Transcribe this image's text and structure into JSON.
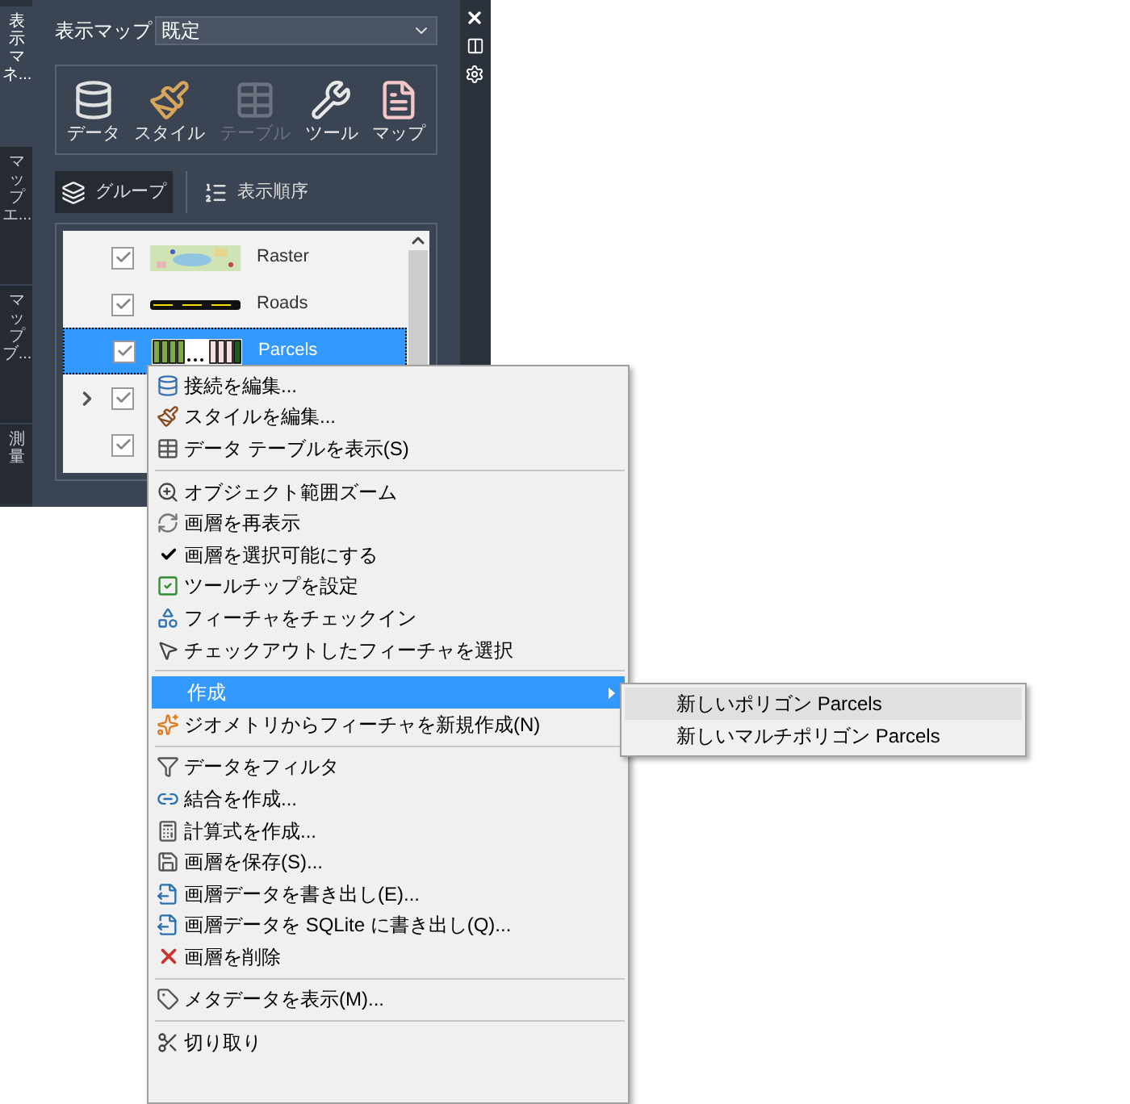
{
  "side_tabs": [
    {
      "label": "表示マネ...",
      "selected": true
    },
    {
      "label": "マップエ...",
      "selected": false
    },
    {
      "label": "マップブ...",
      "selected": false
    },
    {
      "label": "測量",
      "selected": false
    }
  ],
  "map_select": {
    "label": "表示マップ",
    "value": "既定"
  },
  "toolbar": [
    {
      "label": "データ",
      "disabled": false
    },
    {
      "label": "スタイル",
      "disabled": false
    },
    {
      "label": "テーブル",
      "disabled": true
    },
    {
      "label": "ツール",
      "disabled": false
    },
    {
      "label": "マップ",
      "disabled": false
    }
  ],
  "view_toggle": [
    {
      "label": "グループ",
      "selected": true
    },
    {
      "label": "表示順序",
      "selected": false
    }
  ],
  "layers": [
    {
      "name": "Raster",
      "checked": true,
      "selected": false,
      "expandable": false
    },
    {
      "name": "Roads",
      "checked": true,
      "selected": false,
      "expandable": false
    },
    {
      "name": "Parcels",
      "checked": true,
      "selected": true,
      "expandable": false
    },
    {
      "checked": true,
      "selected": false,
      "expandable": true
    },
    {
      "checked": true,
      "selected": false,
      "expandable": false
    }
  ],
  "context_menu": [
    {
      "kind": "item",
      "label": "接続を編集..."
    },
    {
      "kind": "item",
      "label": "スタイルを編集..."
    },
    {
      "kind": "item",
      "label": "データ テーブルを表示(S)"
    },
    {
      "kind": "separator"
    },
    {
      "kind": "item",
      "label": "オブジェクト範囲ズーム"
    },
    {
      "kind": "item",
      "label": "画層を再表示"
    },
    {
      "kind": "check",
      "label": "画層を選択可能にする",
      "checked": true
    },
    {
      "kind": "item",
      "label": "ツールチップを設定"
    },
    {
      "kind": "item",
      "label": "フィーチャをチェックイン"
    },
    {
      "kind": "item",
      "label": "チェックアウトしたフィーチャを選択"
    },
    {
      "kind": "separator"
    },
    {
      "kind": "submenu",
      "label": "作成",
      "selected": true
    },
    {
      "kind": "item",
      "label": "ジオメトリからフィーチャを新規作成(N)"
    },
    {
      "kind": "separator"
    },
    {
      "kind": "item",
      "label": "データをフィルタ"
    },
    {
      "kind": "item",
      "label": "結合を作成..."
    },
    {
      "kind": "item",
      "label": "計算式を作成..."
    },
    {
      "kind": "item",
      "label": "画層を保存(S)..."
    },
    {
      "kind": "item",
      "label": "画層データを書き出し(E)..."
    },
    {
      "kind": "item",
      "label": "画層データを SQLite に書き出し(Q)..."
    },
    {
      "kind": "item",
      "label": "画層を削除"
    },
    {
      "kind": "separator"
    },
    {
      "kind": "item",
      "label": "メタデータを表示(M)..."
    },
    {
      "kind": "separator"
    },
    {
      "kind": "item",
      "label": "切り取り"
    }
  ],
  "submenu": [
    {
      "label": "新しいポリゴン Parcels",
      "selected": true
    },
    {
      "label": "新しいマルチポリゴン Parcels",
      "selected": false
    }
  ]
}
